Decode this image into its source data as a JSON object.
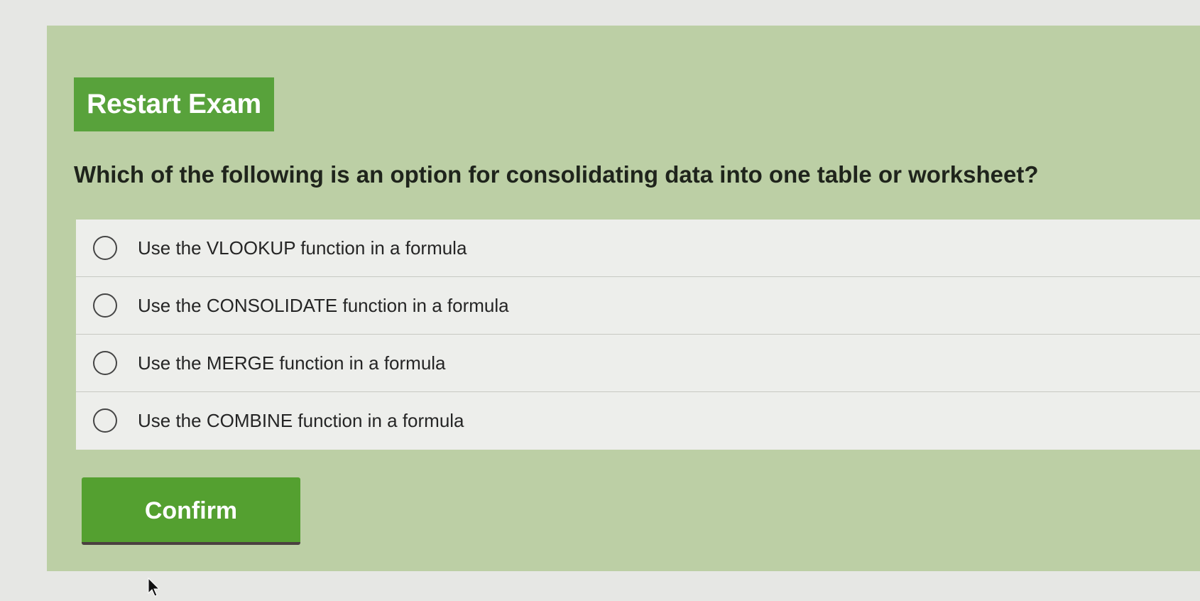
{
  "exam": {
    "restart_label": "Restart Exam",
    "question": "Which of the following is an option for consolidating data into one table or worksheet?",
    "options": [
      {
        "label": "Use the VLOOKUP function in a formula",
        "selected": false
      },
      {
        "label": "Use the CONSOLIDATE function in a formula",
        "selected": false
      },
      {
        "label": "Use the MERGE function in a formula",
        "selected": false
      },
      {
        "label": "Use the COMBINE function in a formula",
        "selected": false
      }
    ],
    "confirm_label": "Confirm"
  },
  "colors": {
    "panel_background": "#bccfa5",
    "button_green": "#58a23b",
    "options_background": "#edeeeb",
    "page_background": "#e6e7e4"
  },
  "icons": {
    "radio": "radio-unchecked-icon",
    "cursor": "mouse-pointer-icon"
  }
}
